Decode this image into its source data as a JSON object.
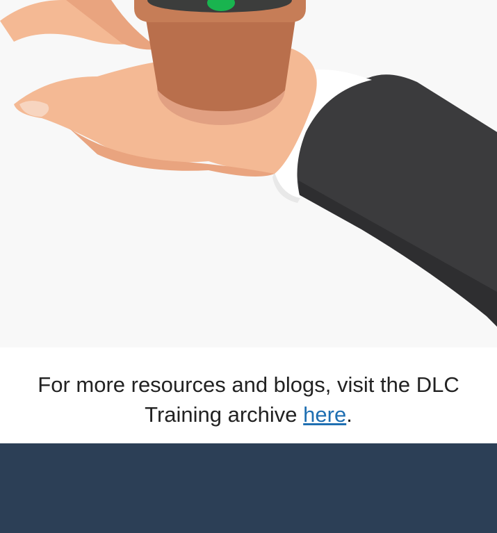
{
  "caption": {
    "line1": "For more resources and blogs, visit the DLC",
    "line2_prefix": "Training archive ",
    "link_text": "here",
    "line2_suffix": "."
  },
  "colors": {
    "background": "#f8f8f8",
    "footer": "#2c3f56",
    "link": "#1f6fb2",
    "skin": "#f4b994",
    "pot": "#b96f4c",
    "suit": "#3b3b3d",
    "cuff": "#ffffff",
    "soil": "#3c3d3c",
    "sprout": "#19b44f"
  },
  "icons": {
    "illustration": "hand-holding-plant-pot"
  }
}
